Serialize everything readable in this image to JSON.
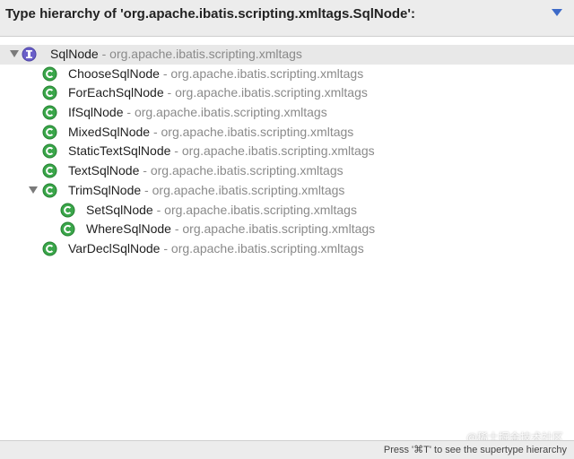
{
  "header": {
    "title": "Type hierarchy of 'org.apache.ibatis.scripting.xmltags.SqlNode':",
    "menu_icon": "chevron-down-icon"
  },
  "tree": {
    "root": {
      "name": "SqlNode",
      "package": "org.apache.ibatis.scripting.xmltags",
      "icon": "interface-icon",
      "expanded": true,
      "selected": true
    },
    "separator": " - ",
    "children": [
      {
        "name": "ChooseSqlNode",
        "package": "org.apache.ibatis.scripting.xmltags",
        "icon": "class-icon"
      },
      {
        "name": "ForEachSqlNode",
        "package": "org.apache.ibatis.scripting.xmltags",
        "icon": "class-icon"
      },
      {
        "name": "IfSqlNode",
        "package": "org.apache.ibatis.scripting.xmltags",
        "icon": "class-icon"
      },
      {
        "name": "MixedSqlNode",
        "package": "org.apache.ibatis.scripting.xmltags",
        "icon": "class-icon"
      },
      {
        "name": "StaticTextSqlNode",
        "package": "org.apache.ibatis.scripting.xmltags",
        "icon": "class-icon"
      },
      {
        "name": "TextSqlNode",
        "package": "org.apache.ibatis.scripting.xmltags",
        "icon": "class-icon"
      },
      {
        "name": "TrimSqlNode",
        "package": "org.apache.ibatis.scripting.xmltags",
        "icon": "class-icon",
        "expanded": true,
        "children": [
          {
            "name": "SetSqlNode",
            "package": "org.apache.ibatis.scripting.xmltags",
            "icon": "class-icon"
          },
          {
            "name": "WhereSqlNode",
            "package": "org.apache.ibatis.scripting.xmltags",
            "icon": "class-icon"
          }
        ]
      },
      {
        "name": "VarDeclSqlNode",
        "package": "org.apache.ibatis.scripting.xmltags",
        "icon": "class-icon"
      }
    ]
  },
  "status": {
    "hint": "Press '⌘T' to see the supertype hierarchy"
  },
  "watermark": "@稀土掘金技术社区",
  "colors": {
    "class_icon": "#3aa64a",
    "interface_icon": "#6a5fc9",
    "selection": "#e8e8e8",
    "dropdown_accent": "#3d6ac8"
  }
}
